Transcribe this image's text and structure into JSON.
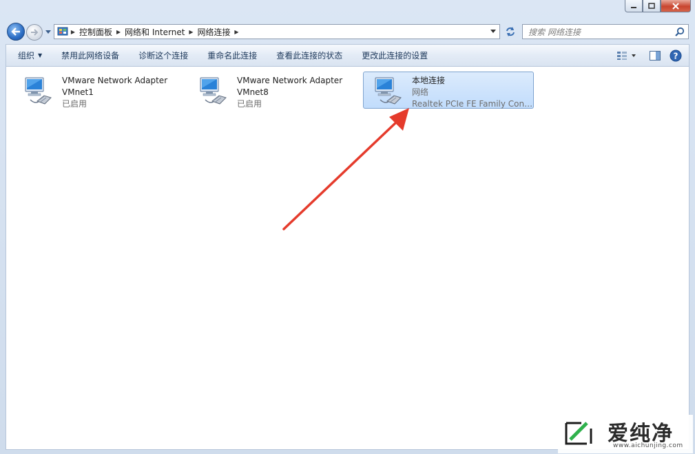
{
  "window": {
    "caption_buttons": [
      "minimize-icon",
      "maximize-icon",
      "close-icon"
    ]
  },
  "navigation": {
    "breadcrumbs": [
      "控制面板",
      "网络和 Internet",
      "网络连接"
    ],
    "search_placeholder": "搜索 网络连接"
  },
  "toolbar": {
    "organize_label": "组织",
    "disable_label": "禁用此网络设备",
    "diagnose_label": "诊断这个连接",
    "rename_label": "重命名此连接",
    "status_label": "查看此连接的状态",
    "settings_label": "更改此连接的设置"
  },
  "connections": [
    {
      "name": "VMware Network Adapter",
      "subtitle": "VMnet1",
      "status": "已启用",
      "selected": false
    },
    {
      "name": "VMware Network Adapter",
      "subtitle": "VMnet8",
      "status": "已启用",
      "selected": false
    },
    {
      "name": "本地连接",
      "subtitle": "网络",
      "status": "Realtek PCIe FE Family Control...",
      "selected": true
    }
  ],
  "annotation": {
    "arrow_color": "#e53b2c"
  },
  "watermark": {
    "text": "爱纯净",
    "url": "www.aichunjing.com"
  },
  "colors": {
    "selection_bg": "#c1dcfc",
    "toolbar_text": "#1e395b",
    "accent": "#2b6dc4"
  }
}
